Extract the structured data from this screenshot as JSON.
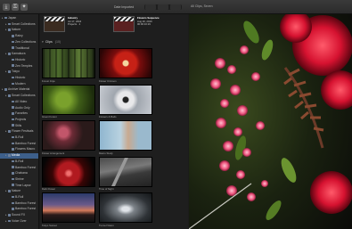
{
  "toolbar": {
    "icons": [
      "import-icon",
      "keyword-icon",
      "effects-icon"
    ],
    "browser_title": "Date Imported",
    "viewer_title": "All Clips, Seven"
  },
  "sidebar": {
    "items": [
      {
        "label": "Japan",
        "level": 0,
        "selected": false
      },
      {
        "label": "Smart Collections",
        "level": 1,
        "selected": false
      },
      {
        "label": "Nature",
        "level": 1,
        "selected": false
      },
      {
        "label": "Rainy",
        "level": 2,
        "selected": false
      },
      {
        "label": "Zen Collections",
        "level": 2,
        "selected": false
      },
      {
        "label": "Traditional",
        "level": 2,
        "selected": false
      },
      {
        "label": "Kamakura",
        "level": 1,
        "selected": false
      },
      {
        "label": "Historic",
        "level": 2,
        "selected": false
      },
      {
        "label": "Zen Temples",
        "level": 2,
        "selected": false
      },
      {
        "label": "Tokyo",
        "level": 1,
        "selected": false
      },
      {
        "label": "Historic",
        "level": 2,
        "selected": false
      },
      {
        "label": "Modern",
        "level": 2,
        "selected": false
      },
      {
        "label": "Archive Material",
        "level": 0,
        "selected": false
      },
      {
        "label": "Smart Collections",
        "level": 1,
        "selected": false
      },
      {
        "label": "All Video",
        "level": 2,
        "selected": false
      },
      {
        "label": "Audio Only",
        "level": 2,
        "selected": false
      },
      {
        "label": "Favorites",
        "level": 2,
        "selected": false
      },
      {
        "label": "Projects",
        "level": 2,
        "selected": false
      },
      {
        "label": "Stills",
        "level": 2,
        "selected": false
      },
      {
        "label": "Flower Festivals",
        "level": 1,
        "selected": false
      },
      {
        "label": "B-Roll",
        "level": 2,
        "selected": false
      },
      {
        "label": "Bamboo Forest",
        "level": 2,
        "selected": false
      },
      {
        "label": "Flowers Macro",
        "level": 2,
        "selected": false
      },
      {
        "label": "Media",
        "level": 1,
        "selected": true
      },
      {
        "label": "B-Roll",
        "level": 2,
        "selected": false
      },
      {
        "label": "Bamboo Forest",
        "level": 2,
        "selected": false
      },
      {
        "label": "Chabana",
        "level": 2,
        "selected": false
      },
      {
        "label": "Shrine",
        "level": 2,
        "selected": false
      },
      {
        "label": "Time Lapse",
        "level": 2,
        "selected": false
      },
      {
        "label": "Nature",
        "level": 1,
        "selected": false
      },
      {
        "label": "B-Roll",
        "level": 2,
        "selected": false
      },
      {
        "label": "Bamboo Forest",
        "level": 2,
        "selected": false
      },
      {
        "label": "Bamboo Forest",
        "level": 2,
        "selected": false
      },
      {
        "label": "Sound FX",
        "level": 1,
        "selected": false
      },
      {
        "label": "Voice Over",
        "level": 1,
        "selected": false
      }
    ]
  },
  "browser": {
    "projects": [
      {
        "name": "Industry",
        "line1": "Jul 17, 2016",
        "line2": "Projects · 1"
      },
      {
        "name": "Flowers Sequence",
        "line1": "Aug 20, 2016",
        "line2": "00:00:10:19"
      }
    ],
    "clips_header": "Clips",
    "clips_count": "(10)",
    "clips": [
      {
        "label": "Forest Jinja",
        "art": "t-forest"
      },
      {
        "label": "Flower Crimson",
        "art": "t-redflower"
      },
      {
        "label": "Green Forest",
        "art": "t-greenbokeh"
      },
      {
        "label": "Flowers & Buds",
        "art": "t-whiteflower"
      },
      {
        "label": "Flower Arrangement",
        "art": "t-pinkflowers"
      },
      {
        "label": "Macro Study",
        "art": "t-portrait"
      },
      {
        "label": "Dark Flower",
        "art": "t-darkred"
      },
      {
        "label": "Time of Night",
        "art": "t-street"
      },
      {
        "label": "Tokyo Sunset",
        "art": "t-sunset"
      },
      {
        "label": "Tunnel Vision",
        "art": "t-tunnel"
      }
    ]
  },
  "viewer": {
    "image": "red-flower-arrangement"
  }
}
